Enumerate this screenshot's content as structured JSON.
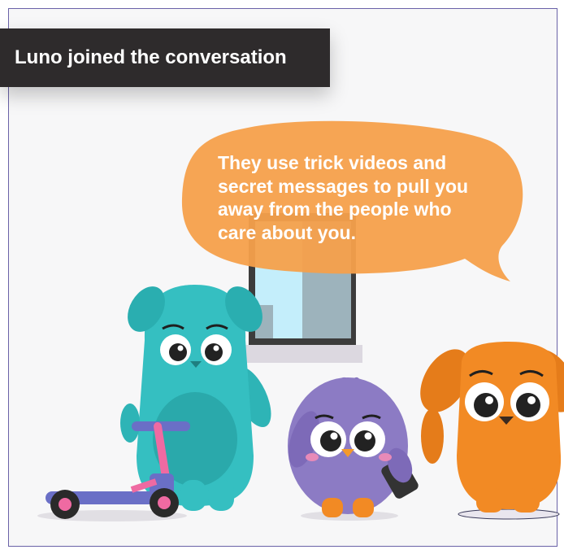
{
  "banner": {
    "text": "Luno joined the conversation"
  },
  "speech_bubble": {
    "text": "They use trick videos and secret messages to pull you away from the people who care about you."
  },
  "characters": [
    {
      "name-icon": "teal-dog-icon"
    },
    {
      "name-icon": "purple-bird-icon"
    },
    {
      "name-icon": "orange-dog-icon"
    }
  ],
  "colors": {
    "banner_bg": "#2e2b2c",
    "bubble": "#f5a04b",
    "teal": "#35bfc1",
    "purple": "#8c7bc4",
    "orange": "#f28a24",
    "scooter": "#6a6fc6"
  }
}
